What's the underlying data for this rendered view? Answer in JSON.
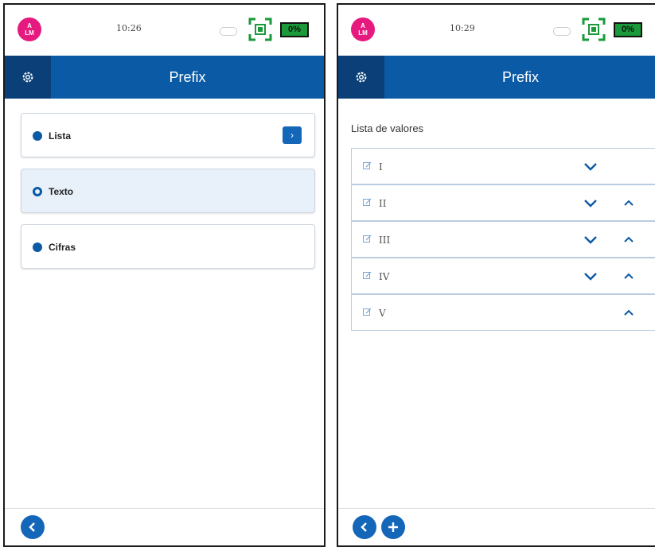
{
  "left": {
    "status": {
      "avatar_text_top": "A",
      "avatar_text_bottom": "LM",
      "time": "10:26",
      "battery_pct": "0%"
    },
    "header": {
      "title": "Prefix"
    },
    "options": [
      {
        "label": "Lista",
        "style": "filled",
        "has_arrow": true,
        "selected": false
      },
      {
        "label": "Texto",
        "style": "ring",
        "has_arrow": false,
        "selected": true
      },
      {
        "label": "Cifras",
        "style": "filled",
        "has_arrow": false,
        "selected": false
      }
    ],
    "arrow_glyph": "›"
  },
  "right": {
    "status": {
      "avatar_text_top": "A",
      "avatar_text_bottom": "LM",
      "time": "10:29",
      "battery_pct": "0%"
    },
    "header": {
      "title": "Prefix"
    },
    "list_title": "Lista de valores",
    "rows": [
      {
        "value": "I",
        "down": true,
        "up": false
      },
      {
        "value": "II",
        "down": true,
        "up": true
      },
      {
        "value": "III",
        "down": true,
        "up": true
      },
      {
        "value": "IV",
        "down": true,
        "up": true
      },
      {
        "value": "V",
        "down": false,
        "up": true
      }
    ]
  },
  "colors": {
    "primary": "#0b5aa6",
    "header_dark": "#0a3f78",
    "avatar": "#e6197e",
    "battery": "#1a9a3a"
  }
}
